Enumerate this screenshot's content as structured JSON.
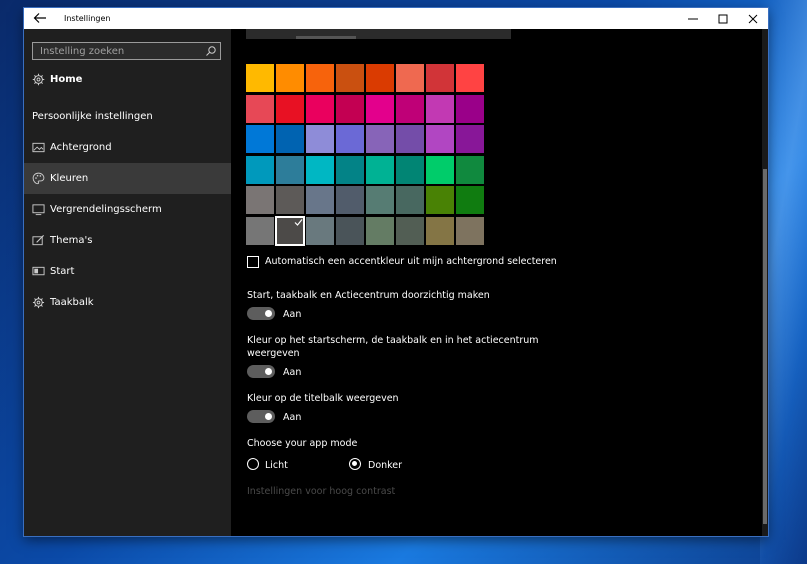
{
  "window": {
    "title": "Instellingen",
    "controls": {
      "minimize": "—",
      "maximize": "☐",
      "close": "✕"
    }
  },
  "sidebar": {
    "search_placeholder": "Instelling zoeken",
    "home": "Home",
    "section": "Persoonlijke instellingen",
    "items": [
      {
        "label": "Achtergrond",
        "icon": "picture-icon"
      },
      {
        "label": "Kleuren",
        "icon": "palette-icon",
        "active": true
      },
      {
        "label": "Vergrendelingsscherm",
        "icon": "lock-screen-icon"
      },
      {
        "label": "Thema's",
        "icon": "theme-icon"
      },
      {
        "label": "Start",
        "icon": "start-icon"
      },
      {
        "label": "Taakbalk",
        "icon": "taskbar-icon"
      }
    ]
  },
  "colors": {
    "grid": [
      [
        "#FFB900",
        "#FF8C00",
        "#F7630C",
        "#CA5010",
        "#DA3B01",
        "#EF6950",
        "#D13438",
        "#FF4343"
      ],
      [
        "#E74856",
        "#E81123",
        "#EA005E",
        "#C30052",
        "#E3008C",
        "#BF0077",
        "#C239B3",
        "#9A0089"
      ],
      [
        "#0078D7",
        "#0063B1",
        "#8E8CD8",
        "#6B69D6",
        "#8764B8",
        "#744DA9",
        "#B146C2",
        "#881798"
      ],
      [
        "#0099BC",
        "#2D7D9A",
        "#00B7C3",
        "#038387",
        "#00B294",
        "#018574",
        "#00CC6A",
        "#10893E"
      ],
      [
        "#7A7574",
        "#5D5A58",
        "#68768A",
        "#515C6B",
        "#567C73",
        "#486860",
        "#498205",
        "#107C10"
      ],
      [
        "#767676",
        "#4C4A48",
        "#69797E",
        "#4A5459",
        "#647C64",
        "#525E54",
        "#847545",
        "#7E735F"
      ]
    ],
    "selected_row": 5,
    "selected_col": 1
  },
  "settings": {
    "auto_accent": "Automatisch een accentkleur uit mijn achtergrond selecteren",
    "transparency": {
      "label": "Start, taakbalk en Actiecentrum doorzichtig maken",
      "state": "Aan"
    },
    "color_start": {
      "label_line1": "Kleur op het startscherm, de taakbalk en in het actiecentrum",
      "label_line2": "weergeven",
      "state": "Aan"
    },
    "color_titlebar": {
      "label": "Kleur op de titelbalk weergeven",
      "state": "Aan"
    },
    "app_mode": {
      "label": "Choose your app mode",
      "light": "Licht",
      "dark": "Donker",
      "selected": "dark"
    },
    "high_contrast": "Instellingen voor hoog contrast"
  }
}
